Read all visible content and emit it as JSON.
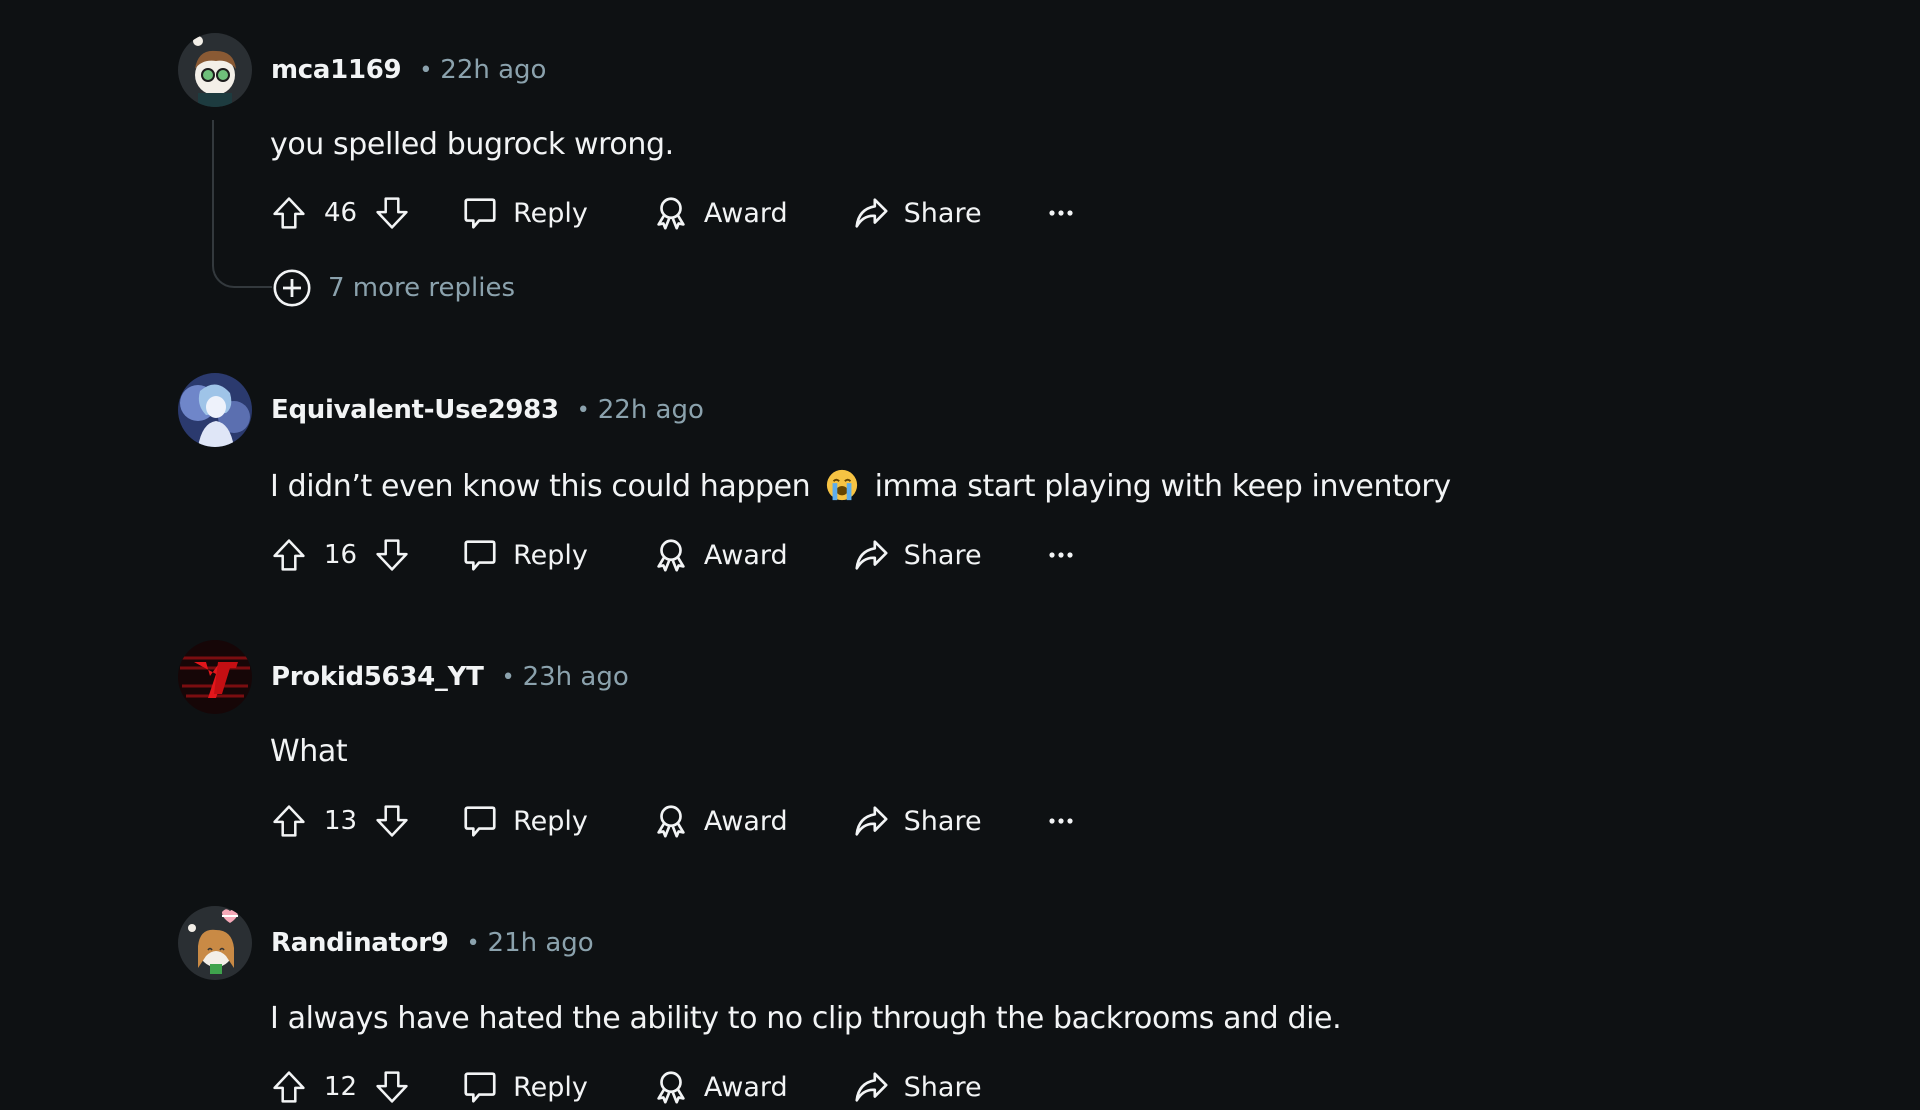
{
  "comments": [
    {
      "username": "mca1169",
      "separator": "•",
      "time": "22h ago",
      "text": "you spelled bugrock wrong.",
      "score": "46",
      "avatar": "avatar-glasses-icon",
      "more_replies": "7 more replies"
    },
    {
      "username": "Equivalent-Use2983",
      "separator": "•",
      "time": "22h ago",
      "text_before_emoji": "I didn’t even know this could happen",
      "emoji": "loudly-crying-face-emoji",
      "text_after_emoji": "imma start playing with keep inventory",
      "score": "16",
      "avatar": "avatar-anime-icon"
    },
    {
      "username": "Prokid5634_YT",
      "separator": "•",
      "time": "23h ago",
      "text": "What",
      "score": "13",
      "avatar": "avatar-yt-logo-icon"
    },
    {
      "username": "Randinator9",
      "separator": "•",
      "time": "21h ago",
      "text": "I always have hated the ability to no clip through the backrooms and die.",
      "score": "12",
      "avatar": "avatar-snoo-heart-icon"
    }
  ],
  "actions": {
    "reply": "Reply",
    "award": "Award",
    "share": "Share"
  },
  "colors": {
    "background": "#0e1113",
    "text": "#f2f4f5",
    "meta": "#8ba2ad",
    "thread_line": "#33393d"
  }
}
